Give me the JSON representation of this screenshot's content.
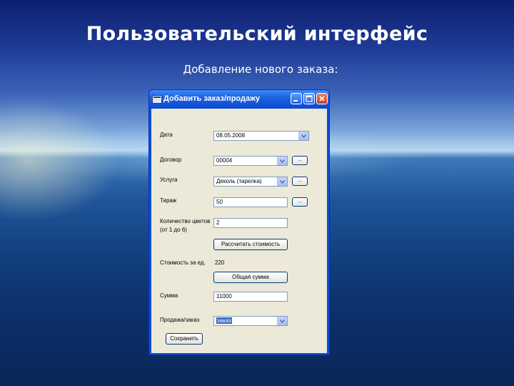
{
  "slide": {
    "title": "Пользовательский интерфейс",
    "subtitle": "Добавление нового заказа:"
  },
  "window": {
    "title": "Добавить заказ/продажу"
  },
  "form": {
    "date": {
      "label": "Дата",
      "value": "08.05.2008"
    },
    "contract": {
      "label": "Договор",
      "value": "00004",
      "browse": "..."
    },
    "service": {
      "label": "Услуга",
      "value": "Деколь (тарелка)",
      "browse": "..."
    },
    "circulation": {
      "label": "Тираж",
      "value": "50",
      "browse": "..."
    },
    "colors": {
      "label_line1": "Количество цветов",
      "label_line2": "(от 1 до 6)",
      "value": "2"
    },
    "calc_button": "Рассчитать стоимость",
    "unit_cost": {
      "label": "Стоимость за ед.",
      "value": "220"
    },
    "total_button": "Общая сумма",
    "sum": {
      "label": "Сумма",
      "value": "11000"
    },
    "type": {
      "label": "Продажа/заказ",
      "value": "заказ"
    },
    "save_button": "Сохранить"
  },
  "icons": {
    "app": "window-app-icon",
    "minimize": "minimize-icon",
    "maximize": "maximize-icon",
    "close": "close-icon",
    "dropdown": "chevron-down-icon"
  },
  "colors": {
    "titlebar": "#0b4ad2",
    "client": "#ece9d8",
    "selection": "#316ac5"
  }
}
